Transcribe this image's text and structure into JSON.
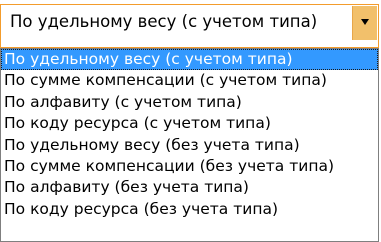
{
  "combo": {
    "selected_value": "По удельному весу (с учетом типа)",
    "dropdown_icon": "chevron-down-icon"
  },
  "options": [
    {
      "label": "По удельному весу (с учетом типа)",
      "selected": true
    },
    {
      "label": "По сумме компенсации (с учетом типа)",
      "selected": false
    },
    {
      "label": "По алфавиту (с учетом типа)",
      "selected": false
    },
    {
      "label": "По коду ресурса (с учетом типа)",
      "selected": false
    },
    {
      "label": "По удельному весу (без учета типа)",
      "selected": false
    },
    {
      "label": "По сумме компенсации (без учета типа)",
      "selected": false
    },
    {
      "label": "По алфавиту (без учета типа)",
      "selected": false
    },
    {
      "label": "По коду ресурса (без учета типа)",
      "selected": false
    }
  ],
  "colors": {
    "combo_border": "#f39c2c",
    "button_bg": "#f2c06b",
    "highlight_bg": "#3399ff",
    "highlight_text": "#ffffff"
  }
}
